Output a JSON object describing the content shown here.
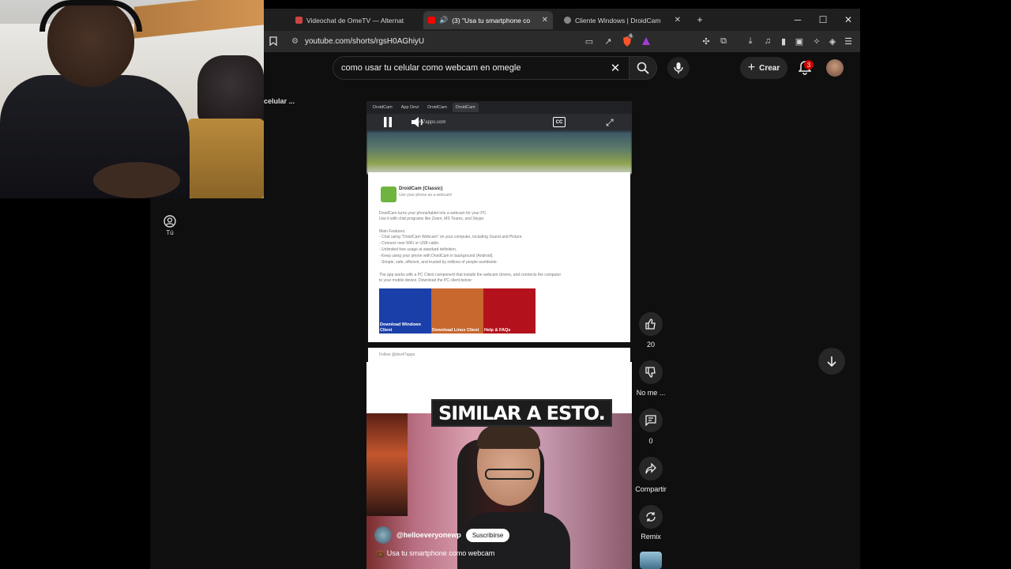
{
  "browser": {
    "tabs": [
      {
        "label": "Videochat de OmeTV — Alternat",
        "active": false
      },
      {
        "label": "(3) \"Usa tu smartphone co",
        "active": true
      },
      {
        "label": "Cliente Windows | DroidCam",
        "active": false
      }
    ],
    "url": "youtube.com/shorts/rgsH0AGhiyU",
    "shield_count": "6"
  },
  "youtube": {
    "search_query": "como usar tu celular como webcam en omegle",
    "create_label": "Crear",
    "notifications": "3",
    "sidebar_you": "Tú",
    "left_clip": "celular ..."
  },
  "short": {
    "caption": "SIMILAR A ESTO.",
    "channel": "@helloeveryonewp",
    "subscribe": "Suscribirse",
    "title": "Usa tu smartphone como webcam",
    "inner": {
      "tabs": [
        "DroidCam",
        "App Devi",
        "DroidCam",
        "DroidCam"
      ],
      "url": "dev47apps.com",
      "app_name": "DroidCam (Classic)",
      "app_tagline": "Use your phone as a webcam!",
      "lines": [
        "DroidCam turns your phone/tablet into a webcam for your PC.",
        "Use it with chat programs like Zoom, MS Teams, and Skype.",
        "",
        "Main Features:",
        "- Chat using \"DroidCam Webcam\" on your computer, including Sound and Picture.",
        "- Connect over WiFi or USB cable.",
        "- Unlimited free usage at standard definition.",
        "- Keep using your phone with DroidCam in background (Android).",
        "- Simple, safe, efficient, and trusted by millions of people worldwide.",
        "",
        "The app works with a PC Client component that installs the webcam drivers, and connects the computer",
        "to your mobile device. Download the PC client below:"
      ],
      "downloads": [
        {
          "label": "Download Windows Client",
          "color": "#1b3fa8"
        },
        {
          "label": "Download Linux Client",
          "color": "#c8672e"
        },
        {
          "label": "Help & FAQs",
          "color": "#b3121d"
        }
      ],
      "follow": "Follow @dev47apps"
    }
  },
  "actions": {
    "likes": "20",
    "dislike": "No me ...",
    "comments": "0",
    "share": "Compartir",
    "remix": "Remix"
  }
}
